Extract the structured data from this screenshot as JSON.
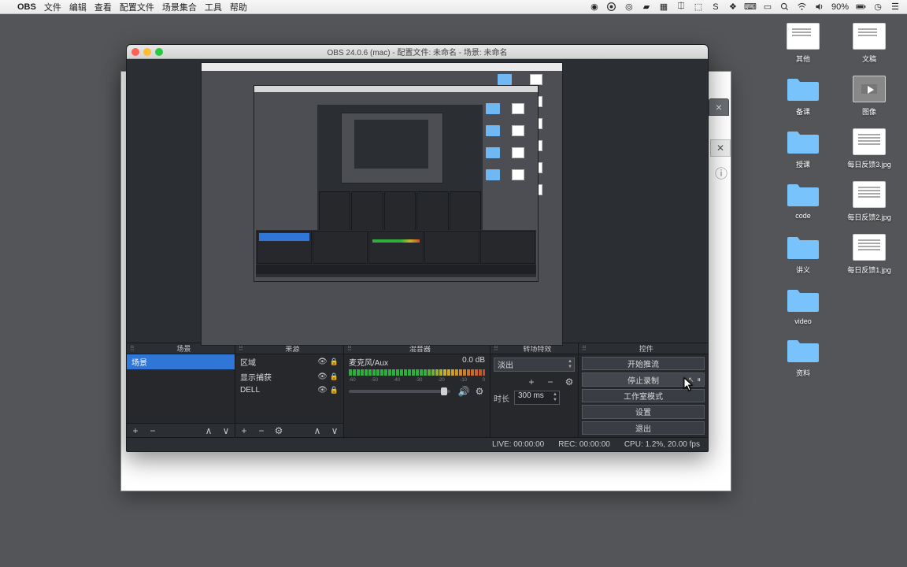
{
  "menubar": {
    "app": "OBS",
    "items": [
      "文件",
      "编辑",
      "查看",
      "配置文件",
      "场景集合",
      "工具",
      "帮助"
    ],
    "battery": "90%"
  },
  "desktop": [
    {
      "icon": "file-doc",
      "label": "其他"
    },
    {
      "icon": "file-doc",
      "label": "文稿"
    },
    {
      "icon": "folder",
      "label": "备课"
    },
    {
      "icon": "file-video",
      "label": "图像"
    },
    {
      "icon": "folder",
      "label": "授课"
    },
    {
      "icon": "file-lines",
      "label": "每日反馈3.jpg"
    },
    {
      "icon": "folder",
      "label": "code"
    },
    {
      "icon": "file-lines",
      "label": "每日反馈2.jpg"
    },
    {
      "icon": "folder",
      "label": "讲义"
    },
    {
      "icon": "file-lines",
      "label": "每日反馈1.jpg"
    },
    {
      "icon": "folder",
      "label": "video"
    },
    {
      "icon": "blank",
      "label": ""
    },
    {
      "icon": "folder",
      "label": "资料"
    }
  ],
  "obs": {
    "title": "OBS 24.0.6 (mac) - 配置文件: 未命名 - 场景: 未命名",
    "docks": {
      "scenes": {
        "title": "场景",
        "items": [
          "场景"
        ]
      },
      "sources": {
        "title": "来源",
        "items": [
          "区域",
          "显示捕获",
          "DELL"
        ]
      },
      "mixer": {
        "title": "混音器",
        "channel": "麦克风/Aux",
        "level": "0.0 dB",
        "ticks": [
          "-60",
          "-50",
          "-40",
          "-30",
          "-20",
          "-10",
          "0"
        ]
      },
      "transitions": {
        "title": "转场特效",
        "selected": "淡出",
        "duration_label": "时长",
        "duration": "300 ms"
      },
      "controls": {
        "title": "控件",
        "start_stream": "开始推流",
        "stop_record": "停止录制",
        "studio": "工作室模式",
        "settings": "设置",
        "exit": "退出"
      }
    },
    "status": {
      "live": "LIVE: 00:00:00",
      "rec": "REC: 00:00:00",
      "cpu": "CPU: 1.2%, 20.00 fps"
    }
  }
}
